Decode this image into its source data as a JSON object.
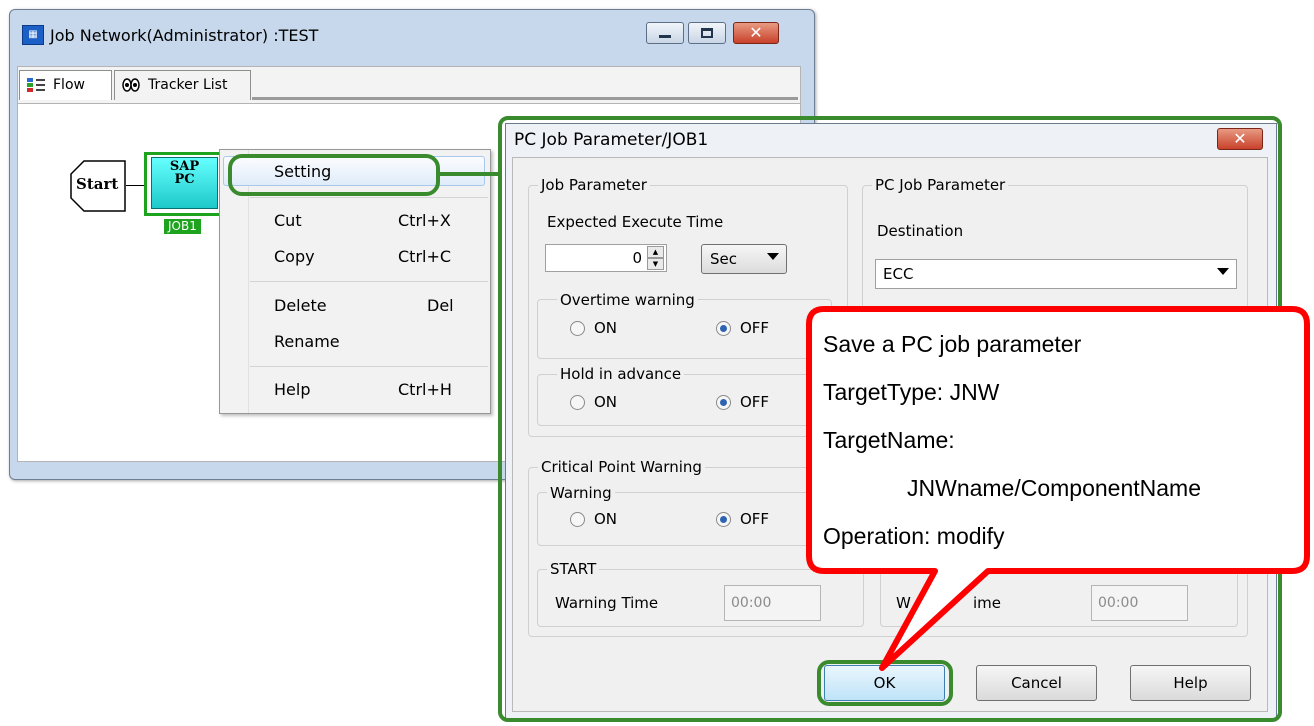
{
  "job_network_window": {
    "title": "Job Network(Administrator) :TEST",
    "title_icon": "network-icon",
    "tabs": [
      {
        "label": "Flow",
        "icon": "flow-icon",
        "selected": true
      },
      {
        "label": "Tracker List",
        "icon": "tracker-icon",
        "selected": false
      }
    ],
    "flow": {
      "start_label": "Start",
      "job_line1": "SAP",
      "job_line2": "PC",
      "job_name": "JOB1"
    }
  },
  "context_menu": {
    "items": [
      {
        "label": "Setting",
        "shortcut": ""
      },
      {
        "label": "Cut",
        "shortcut": "Ctrl+X"
      },
      {
        "label": "Copy",
        "shortcut": "Ctrl+C"
      },
      {
        "label": "Delete",
        "shortcut": "Del"
      },
      {
        "label": "Rename",
        "shortcut": ""
      },
      {
        "label": "Help",
        "shortcut": "Ctrl+H"
      }
    ]
  },
  "dialog": {
    "title": "PC Job Parameter/JOB1",
    "job_parameter": {
      "group_label": "Job Parameter",
      "expected_label": "Expected Execute Time",
      "expected_value": "0",
      "unit": "Sec",
      "overtime": {
        "label": "Overtime warning",
        "on": "ON",
        "off": "OFF",
        "selected": "OFF"
      },
      "hold": {
        "label": "Hold in advance",
        "on": "ON",
        "off": "OFF",
        "selected": "OFF"
      }
    },
    "pc_job_parameter": {
      "group_label": "PC Job Parameter",
      "destination_label": "Destination",
      "destination_value": "ECC"
    },
    "critical": {
      "group_label": "Critical Point Warning",
      "warning": {
        "label": "Warning",
        "on": "ON",
        "off": "OFF",
        "selected": "OFF"
      },
      "start": {
        "label": "START",
        "time_label": "Warning Time",
        "time_value": "00:00"
      },
      "end": {
        "time_label_a": "W",
        "time_label_b": "ime",
        "time_value": "00:00"
      }
    },
    "buttons": {
      "ok": "OK",
      "cancel": "Cancel",
      "help": "Help"
    }
  },
  "callout": {
    "lines": [
      "Save a PC job parameter",
      "TargetType: JNW",
      "TargetName:",
      "JNWname/ComponentName",
      "Operation: modify"
    ],
    "border_color": "#ff0000",
    "highlight_color": "#3a8a2e"
  }
}
